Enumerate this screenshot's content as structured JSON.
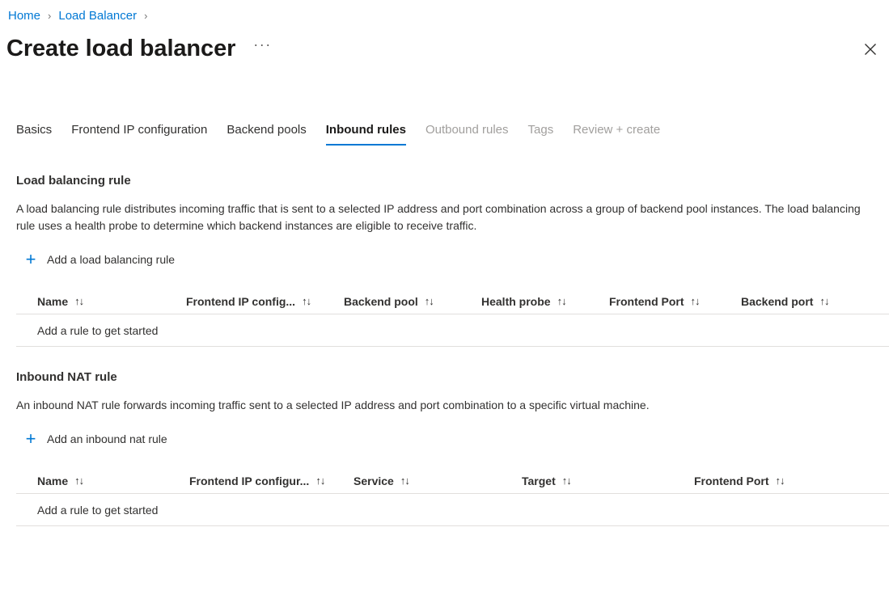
{
  "breadcrumb": {
    "items": [
      {
        "label": "Home"
      },
      {
        "label": "Load Balancer"
      }
    ],
    "separator": "›"
  },
  "header": {
    "title": "Create load balancer",
    "more_label": "···",
    "close_icon": "close-icon"
  },
  "tabs": [
    {
      "label": "Basics",
      "state": "enabled"
    },
    {
      "label": "Frontend IP configuration",
      "state": "enabled"
    },
    {
      "label": "Backend pools",
      "state": "enabled"
    },
    {
      "label": "Inbound rules",
      "state": "active"
    },
    {
      "label": "Outbound rules",
      "state": "disabled"
    },
    {
      "label": "Tags",
      "state": "disabled"
    },
    {
      "label": "Review + create",
      "state": "disabled"
    }
  ],
  "sections": {
    "load_balancing_rule": {
      "heading": "Load balancing rule",
      "description": "A load balancing rule distributes incoming traffic that is sent to a selected IP address and port combination across a group of backend pool instances. The load balancing rule uses a health probe to determine which backend instances are eligible to receive traffic.",
      "add_label": "Add a load balancing rule",
      "add_plus": "+",
      "columns": [
        {
          "label": "Name",
          "sort": "↑↓"
        },
        {
          "label": "Frontend IP config...",
          "sort": "↑↓"
        },
        {
          "label": "Backend pool",
          "sort": "↑↓"
        },
        {
          "label": "Health probe",
          "sort": "↑↓"
        },
        {
          "label": "Frontend Port",
          "sort": "↑↓"
        },
        {
          "label": "Backend port",
          "sort": "↑↓"
        }
      ],
      "empty_text": "Add a rule to get started"
    },
    "inbound_nat_rule": {
      "heading": "Inbound NAT rule",
      "description": "An inbound NAT rule forwards incoming traffic sent to a selected IP address and port combination to a specific virtual machine.",
      "add_label": "Add an inbound nat rule",
      "add_plus": "+",
      "columns": [
        {
          "label": "Name",
          "sort": "↑↓"
        },
        {
          "label": "Frontend IP configur...",
          "sort": "↑↓"
        },
        {
          "label": "Service",
          "sort": "↑↓"
        },
        {
          "label": "Target",
          "sort": "↑↓"
        },
        {
          "label": "Frontend Port",
          "sort": "↑↓"
        }
      ],
      "empty_text": "Add a rule to get started"
    }
  },
  "colors": {
    "accent": "#0078d4",
    "link": "#0078d4",
    "text": "#323130",
    "disabled_text": "#a19f9d",
    "border": "#e1dfdd",
    "background": "#ffffff"
  }
}
